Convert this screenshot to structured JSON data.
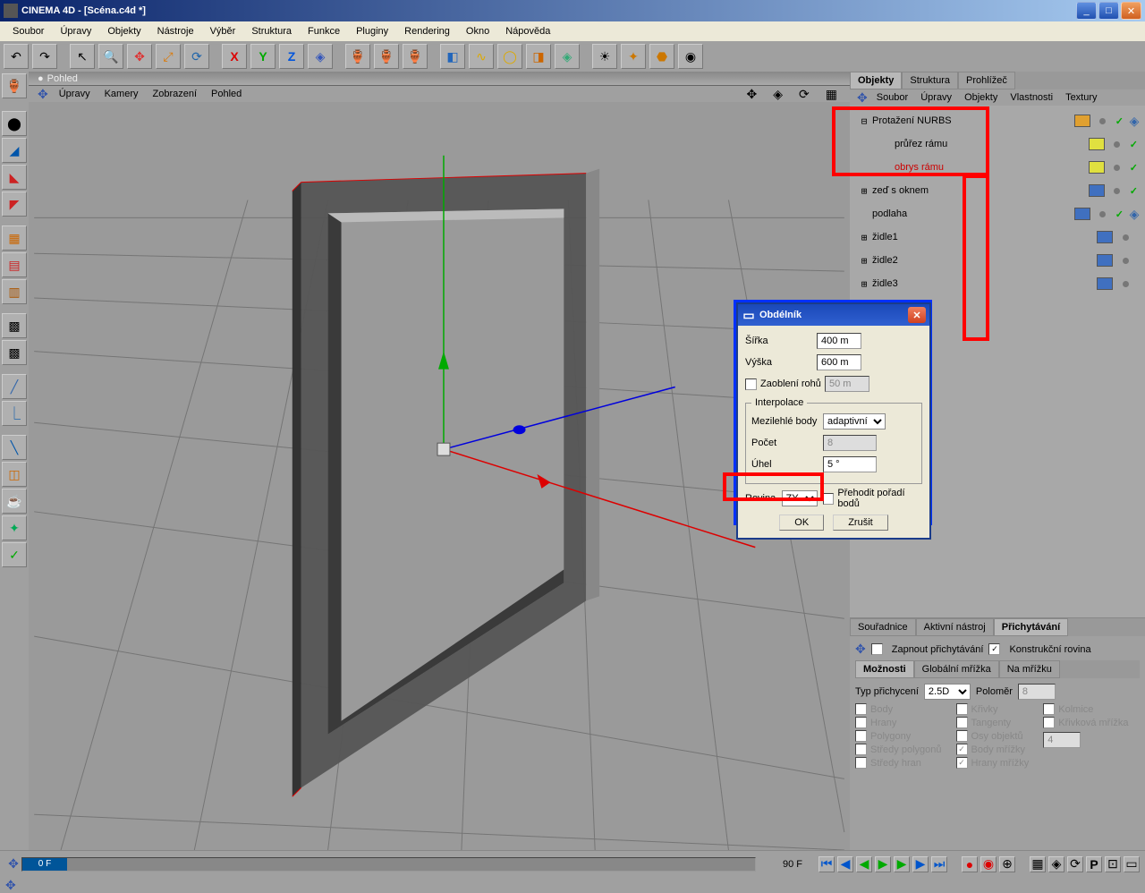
{
  "titlebar": {
    "text": "CINEMA 4D - [Scéna.c4d *]"
  },
  "menubar": [
    "Soubor",
    "Úpravy",
    "Objekty",
    "Nástroje",
    "Výběr",
    "Struktura",
    "Funkce",
    "Pluginy",
    "Rendering",
    "Okno",
    "Nápověda"
  ],
  "viewport": {
    "tab": "Pohled",
    "menubar": [
      "Úpravy",
      "Kamery",
      "Zobrazení",
      "Pohled"
    ]
  },
  "obj_panel": {
    "tabs": [
      "Objekty",
      "Struktura",
      "Prohlížeč"
    ],
    "menu": [
      "Soubor",
      "Úpravy",
      "Objekty",
      "Vlastnosti",
      "Textury"
    ],
    "rows": [
      {
        "expand": "⊟",
        "name": "Protažení NURBS",
        "icon_bg": "#e0a030",
        "name_color": "#000"
      },
      {
        "expand": "",
        "name": "průřez rámu",
        "icon_bg": "#e0e040",
        "indent": 1,
        "name_color": "#000"
      },
      {
        "expand": "",
        "name": "obrys rámu",
        "icon_bg": "#e0e040",
        "indent": 1,
        "name_color": "#c00"
      },
      {
        "expand": "⊞",
        "name": "zeď s oknem",
        "icon_bg": "#4070c0",
        "name_color": "#000"
      },
      {
        "expand": "",
        "name": "podlaha",
        "icon_bg": "#4070c0",
        "name_color": "#000"
      },
      {
        "expand": "⊞",
        "name": "židle1",
        "icon_bg": "#4070c0",
        "name_color": "#000"
      },
      {
        "expand": "⊞",
        "name": "židle2",
        "icon_bg": "#4070c0",
        "name_color": "#000"
      },
      {
        "expand": "⊞",
        "name": "židle3",
        "icon_bg": "#4070c0",
        "name_color": "#000"
      }
    ]
  },
  "dialog": {
    "title": "Obdélník",
    "width_label": "Šířka",
    "width_val": "400 m",
    "height_label": "Výška",
    "height_val": "600 m",
    "rounding_label": "Zaoblení rohů",
    "rounding_val": "50 m",
    "interp_legend": "Interpolace",
    "midpoints_label": "Mezilehlé body",
    "midpoints_val": "adaptivní",
    "count_label": "Počet",
    "count_val": "8",
    "angle_label": "Úhel",
    "angle_val": "5 °",
    "plane_label": "Rovina",
    "plane_val": "ZY",
    "reverse_label": "Přehodit pořadí bodů",
    "ok": "OK",
    "cancel": "Zrušit"
  },
  "bottom": {
    "tabs": [
      "Souřadnice",
      "Aktivní nástroj",
      "Přichytávání"
    ],
    "enable_snap": "Zapnout přichytávání",
    "constr_plane": "Konstrukční rovina",
    "subtabs": [
      "Možnosti",
      "Globální mřížka",
      "Na mřížku"
    ],
    "type_label": "Typ přichycení",
    "type_val": "2.5D",
    "radius_label": "Poloměr",
    "radius_val": "8",
    "col1": [
      "Body",
      "Hrany",
      "Polygony",
      "Středy polygonů",
      "Středy hran"
    ],
    "col2": [
      "Křivky",
      "Tangenty",
      "Osy objektů",
      "Body mřížky",
      "Hrany mřížky"
    ],
    "col3": [
      "Kolmice",
      "Křivková mřížka"
    ],
    "col3_val": "4"
  },
  "timeline": {
    "pos": "0 F",
    "frame": "90 F"
  }
}
